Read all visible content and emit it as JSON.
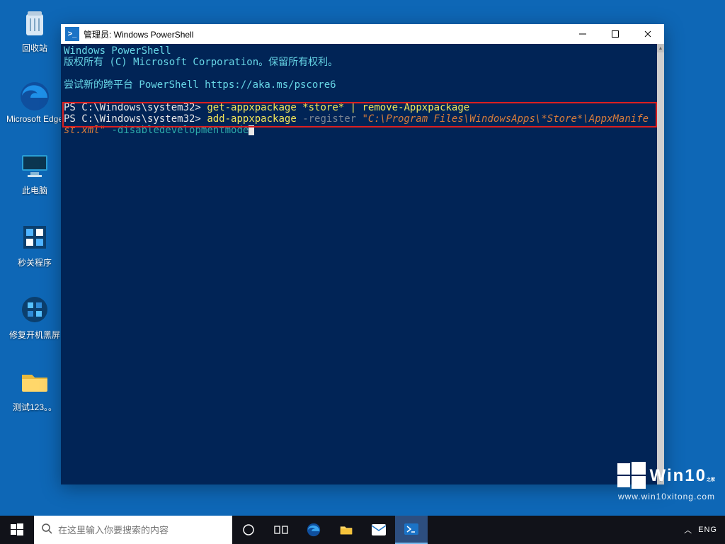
{
  "desktop": {
    "icons": [
      {
        "name": "recycle-bin",
        "label": "回收站"
      },
      {
        "name": "edge",
        "label": "Microsoft Edge"
      },
      {
        "name": "this-pc",
        "label": "此电脑"
      },
      {
        "name": "second-close",
        "label": "秒关程序"
      },
      {
        "name": "repair-boot",
        "label": "修复开机黑屏"
      },
      {
        "name": "test-folder",
        "label": "测试123。。"
      }
    ]
  },
  "powershell": {
    "title": "管理员: Windows PowerShell",
    "banner_app": "Windows PowerShell",
    "banner_copyright": "版权所有 (C) Microsoft Corporation。保留所有权利。",
    "try_new": "尝试新的跨平台 PowerShell https://aka.ms/pscore6",
    "prompt1_prefix": "PS C:\\Windows\\system32>",
    "cmd1_a": "get-appxpackage *store*",
    "cmd1_pipe": "|",
    "cmd1_b": "remove-Appxpackage",
    "prompt2_prefix": "PS C:\\Windows\\system32>",
    "cmd2_a": "add-appxpackage",
    "cmd2_flag1": "-register",
    "cmd2_path": "\"C:\\Program Files\\WindowsApps\\*Store*\\AppxManifest.xml\"",
    "cmd2_flag2": "-disabledevelopmentmode"
  },
  "taskbar": {
    "search_placeholder": "在这里输入你要搜索的内容",
    "ime": "ENG"
  },
  "watermark": {
    "brand": "Win10",
    "suffix": "之家",
    "url": "www.win10xitong.com"
  }
}
